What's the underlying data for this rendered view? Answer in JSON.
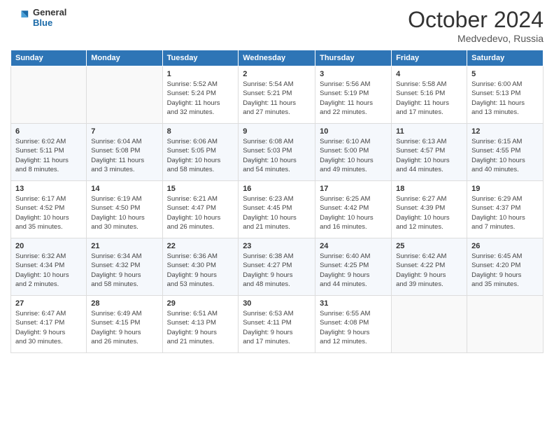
{
  "logo": {
    "line1": "General",
    "line2": "Blue"
  },
  "header": {
    "month": "October 2024",
    "location": "Medvedevo, Russia"
  },
  "weekdays": [
    "Sunday",
    "Monday",
    "Tuesday",
    "Wednesday",
    "Thursday",
    "Friday",
    "Saturday"
  ],
  "weeks": [
    [
      {
        "day": "",
        "info": ""
      },
      {
        "day": "",
        "info": ""
      },
      {
        "day": "1",
        "info": "Sunrise: 5:52 AM\nSunset: 5:24 PM\nDaylight: 11 hours\nand 32 minutes."
      },
      {
        "day": "2",
        "info": "Sunrise: 5:54 AM\nSunset: 5:21 PM\nDaylight: 11 hours\nand 27 minutes."
      },
      {
        "day": "3",
        "info": "Sunrise: 5:56 AM\nSunset: 5:19 PM\nDaylight: 11 hours\nand 22 minutes."
      },
      {
        "day": "4",
        "info": "Sunrise: 5:58 AM\nSunset: 5:16 PM\nDaylight: 11 hours\nand 17 minutes."
      },
      {
        "day": "5",
        "info": "Sunrise: 6:00 AM\nSunset: 5:13 PM\nDaylight: 11 hours\nand 13 minutes."
      }
    ],
    [
      {
        "day": "6",
        "info": "Sunrise: 6:02 AM\nSunset: 5:11 PM\nDaylight: 11 hours\nand 8 minutes."
      },
      {
        "day": "7",
        "info": "Sunrise: 6:04 AM\nSunset: 5:08 PM\nDaylight: 11 hours\nand 3 minutes."
      },
      {
        "day": "8",
        "info": "Sunrise: 6:06 AM\nSunset: 5:05 PM\nDaylight: 10 hours\nand 58 minutes."
      },
      {
        "day": "9",
        "info": "Sunrise: 6:08 AM\nSunset: 5:03 PM\nDaylight: 10 hours\nand 54 minutes."
      },
      {
        "day": "10",
        "info": "Sunrise: 6:10 AM\nSunset: 5:00 PM\nDaylight: 10 hours\nand 49 minutes."
      },
      {
        "day": "11",
        "info": "Sunrise: 6:13 AM\nSunset: 4:57 PM\nDaylight: 10 hours\nand 44 minutes."
      },
      {
        "day": "12",
        "info": "Sunrise: 6:15 AM\nSunset: 4:55 PM\nDaylight: 10 hours\nand 40 minutes."
      }
    ],
    [
      {
        "day": "13",
        "info": "Sunrise: 6:17 AM\nSunset: 4:52 PM\nDaylight: 10 hours\nand 35 minutes."
      },
      {
        "day": "14",
        "info": "Sunrise: 6:19 AM\nSunset: 4:50 PM\nDaylight: 10 hours\nand 30 minutes."
      },
      {
        "day": "15",
        "info": "Sunrise: 6:21 AM\nSunset: 4:47 PM\nDaylight: 10 hours\nand 26 minutes."
      },
      {
        "day": "16",
        "info": "Sunrise: 6:23 AM\nSunset: 4:45 PM\nDaylight: 10 hours\nand 21 minutes."
      },
      {
        "day": "17",
        "info": "Sunrise: 6:25 AM\nSunset: 4:42 PM\nDaylight: 10 hours\nand 16 minutes."
      },
      {
        "day": "18",
        "info": "Sunrise: 6:27 AM\nSunset: 4:39 PM\nDaylight: 10 hours\nand 12 minutes."
      },
      {
        "day": "19",
        "info": "Sunrise: 6:29 AM\nSunset: 4:37 PM\nDaylight: 10 hours\nand 7 minutes."
      }
    ],
    [
      {
        "day": "20",
        "info": "Sunrise: 6:32 AM\nSunset: 4:34 PM\nDaylight: 10 hours\nand 2 minutes."
      },
      {
        "day": "21",
        "info": "Sunrise: 6:34 AM\nSunset: 4:32 PM\nDaylight: 9 hours\nand 58 minutes."
      },
      {
        "day": "22",
        "info": "Sunrise: 6:36 AM\nSunset: 4:30 PM\nDaylight: 9 hours\nand 53 minutes."
      },
      {
        "day": "23",
        "info": "Sunrise: 6:38 AM\nSunset: 4:27 PM\nDaylight: 9 hours\nand 48 minutes."
      },
      {
        "day": "24",
        "info": "Sunrise: 6:40 AM\nSunset: 4:25 PM\nDaylight: 9 hours\nand 44 minutes."
      },
      {
        "day": "25",
        "info": "Sunrise: 6:42 AM\nSunset: 4:22 PM\nDaylight: 9 hours\nand 39 minutes."
      },
      {
        "day": "26",
        "info": "Sunrise: 6:45 AM\nSunset: 4:20 PM\nDaylight: 9 hours\nand 35 minutes."
      }
    ],
    [
      {
        "day": "27",
        "info": "Sunrise: 6:47 AM\nSunset: 4:17 PM\nDaylight: 9 hours\nand 30 minutes."
      },
      {
        "day": "28",
        "info": "Sunrise: 6:49 AM\nSunset: 4:15 PM\nDaylight: 9 hours\nand 26 minutes."
      },
      {
        "day": "29",
        "info": "Sunrise: 6:51 AM\nSunset: 4:13 PM\nDaylight: 9 hours\nand 21 minutes."
      },
      {
        "day": "30",
        "info": "Sunrise: 6:53 AM\nSunset: 4:11 PM\nDaylight: 9 hours\nand 17 minutes."
      },
      {
        "day": "31",
        "info": "Sunrise: 6:55 AM\nSunset: 4:08 PM\nDaylight: 9 hours\nand 12 minutes."
      },
      {
        "day": "",
        "info": ""
      },
      {
        "day": "",
        "info": ""
      }
    ]
  ]
}
